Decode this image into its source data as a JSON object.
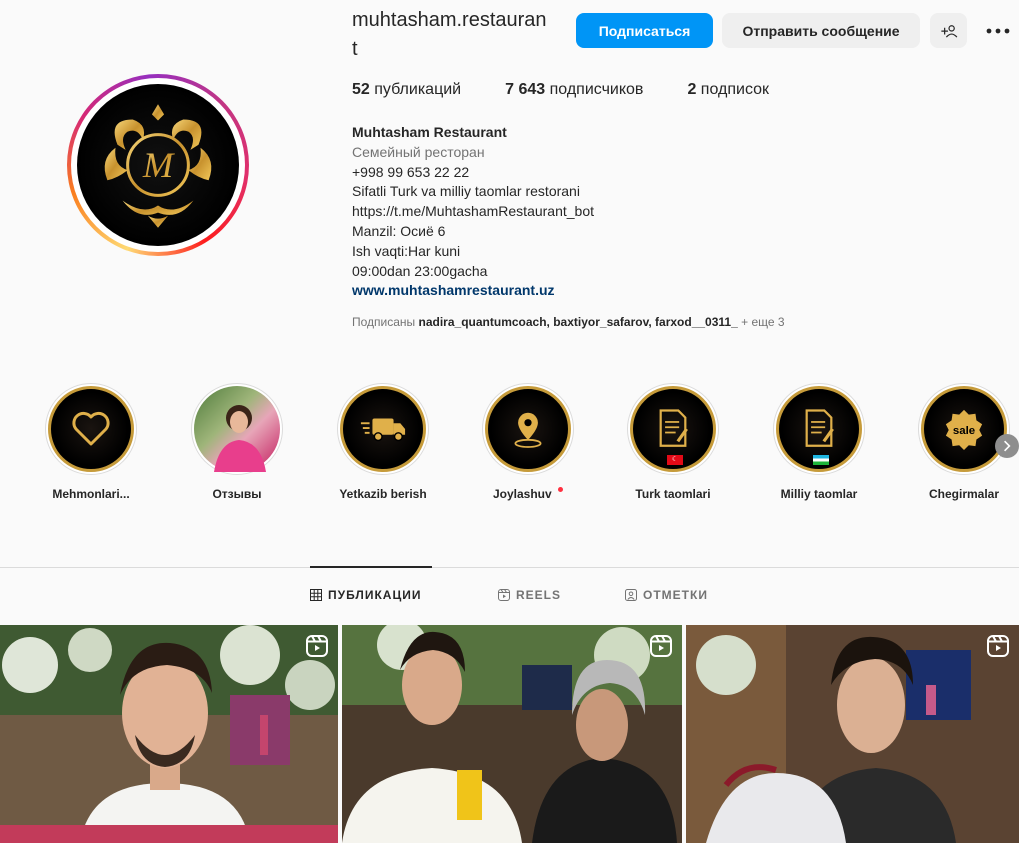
{
  "profile": {
    "username": "muhtasham.restaurant",
    "follow_label": "Подписаться",
    "message_label": "Отправить сообщение",
    "avatar_monogram": "M"
  },
  "stats": {
    "posts_count": "52",
    "posts_label": "публикаций",
    "followers_count": "7 643",
    "followers_label": "подписчиков",
    "following_count": "2",
    "following_label": "подписок"
  },
  "bio": {
    "name": "Muhtasham Restaurant",
    "category": "Семейный ресторан",
    "lines": [
      "+998 99 653 22 22",
      "Sifatli Turk va milliy taomlar restorani",
      "https://t.me/MuhtashamRestaurant_bot",
      "Manzil: Осиё 6",
      "Ish vaqti:Har kuni",
      "09:00dan 23:00gacha"
    ],
    "website": "www.muhtashamrestaurant.uz"
  },
  "followed_by": {
    "prefix": "Подписаны",
    "users": "nadira_quantumcoach, baxtiyor_safarov, farxod__0311_",
    "more": "+ еще 3"
  },
  "highlights": [
    {
      "label": "Mehmonlari...",
      "icon": "heart-icon"
    },
    {
      "label": "Отзывы",
      "icon": "photo"
    },
    {
      "label": "Yetkazib berish",
      "icon": "truck-icon"
    },
    {
      "label": "Joylashuv",
      "icon": "location-pin-icon"
    },
    {
      "label": "Turk taomlari",
      "icon": "menu-document-icon",
      "flag": "turkey"
    },
    {
      "label": "Milliy taomlar",
      "icon": "menu-document-icon",
      "flag": "uzbekistan"
    },
    {
      "label": "Chegirmalar",
      "icon": "sale-badge-icon",
      "badge_text": "sale"
    }
  ],
  "tabs": [
    {
      "label": "ПУБЛИКАЦИИ",
      "active": true
    },
    {
      "label": "REELS",
      "active": false
    },
    {
      "label": "ОТМЕТКИ",
      "active": false
    }
  ],
  "colors": {
    "accent": "#0095f6",
    "gold": "#c69b3a",
    "link": "#00376b",
    "notification_dot": "#ff3040"
  }
}
